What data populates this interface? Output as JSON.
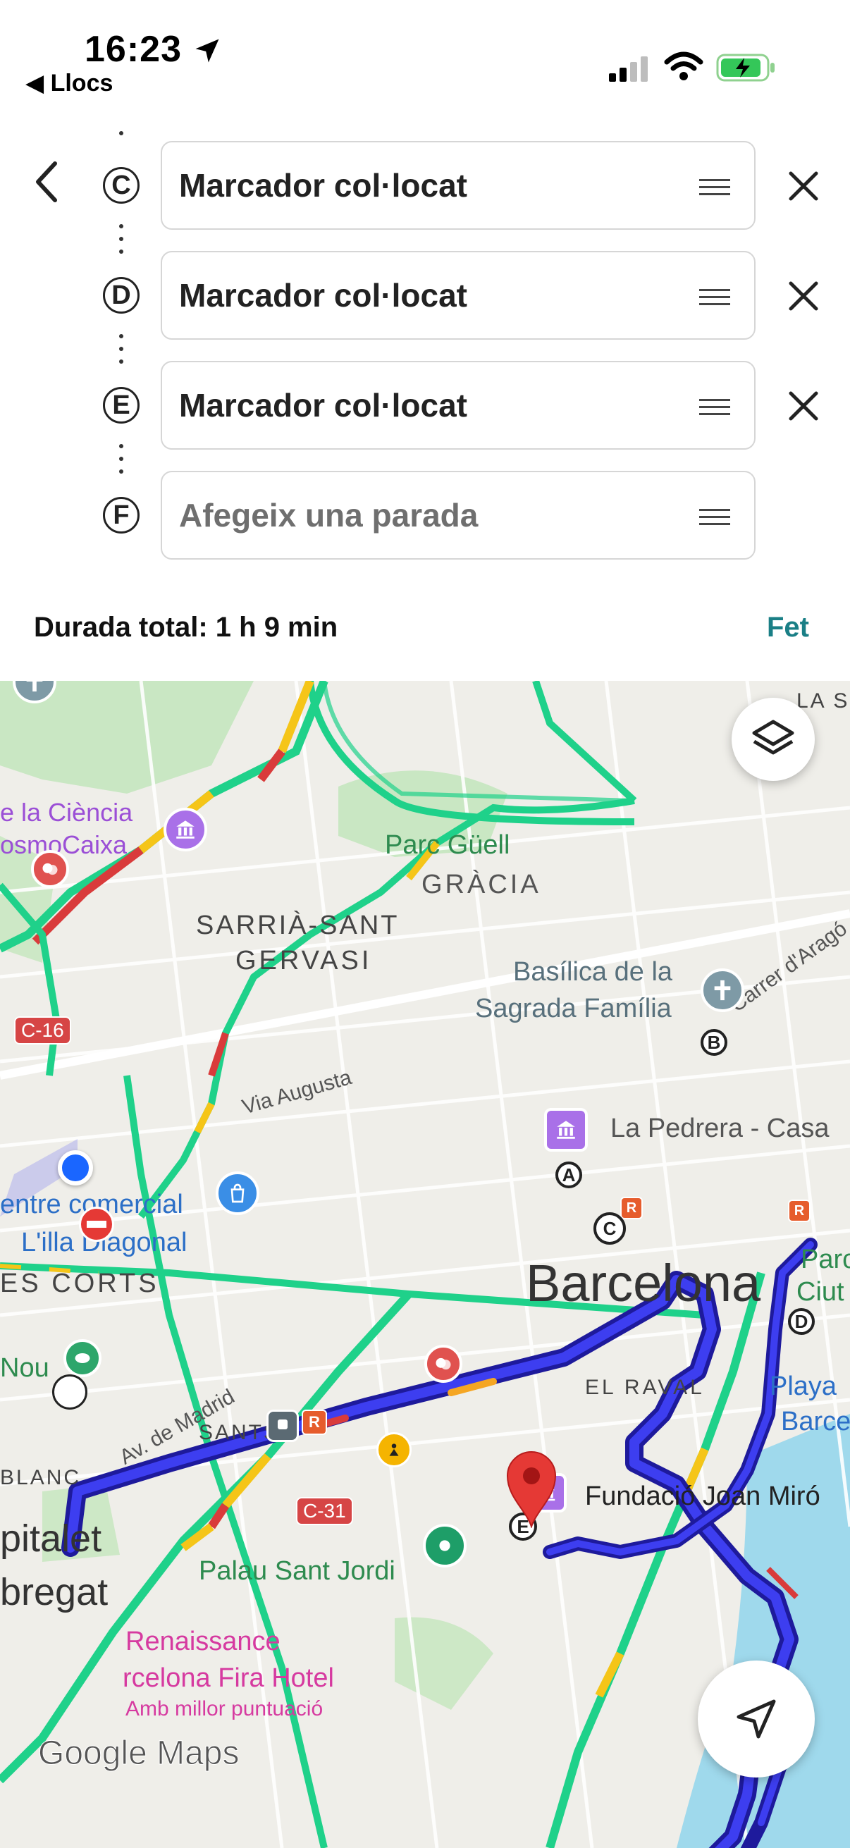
{
  "status_bar": {
    "time": "16:23",
    "back_app": "◀ Llocs"
  },
  "stops": [
    {
      "letter": "C",
      "value": "Marcador col·locat",
      "placeholder": ""
    },
    {
      "letter": "D",
      "value": "Marcador col·locat",
      "placeholder": ""
    },
    {
      "letter": "E",
      "value": "Marcador col·locat",
      "placeholder": ""
    },
    {
      "letter": "F",
      "value": "",
      "placeholder": "Afegeix una parada"
    }
  ],
  "summary": {
    "total_duration": "Durada total: 1 h 9 min",
    "done_label": "Fet"
  },
  "map": {
    "labels": {
      "la_s": "LA S",
      "ciencia": "e la Ciència",
      "cosmocaixa": "osmoCaixa",
      "parc_guell": "Parc Güell",
      "gracia": "GRÀCIA",
      "sarria": "SARRIÀ-SANT",
      "gervasi": "GERVASI",
      "basilica1": "Basílica de la",
      "basilica2": "Sagrada Família",
      "carrer_arago": "Carrer d'Aragó",
      "c16": "C-16",
      "via_augusta": "Via Augusta",
      "pedrera": "La Pedrera - Casa",
      "centre_comercial": "entre comercial",
      "illa": "L'illa Diagonal",
      "les_corts": "ES CORTS",
      "barcelona": "Barcelona",
      "parc": "Parc",
      "ciut": "Ciut",
      "nou": "Nou",
      "av_madrid": "Av. de Madrid",
      "el_raval": "EL RAVAL",
      "playa": "Playa",
      "barcelo": "Barcelo",
      "sants": "SANTS",
      "blanc": "BLANC",
      "c31": "C-31",
      "fundacio": "Fundació Joan Miró",
      "pitalet": "pitalet",
      "bregat": "bregat",
      "palau": "Palau Sant Jordi",
      "renaissance": "Renaissance",
      "fira_hotel": "rcelona Fira Hotel",
      "millor": "Amb millor puntuació",
      "logo": "Google Maps"
    },
    "markers": [
      "A",
      "B",
      "C",
      "D",
      "E"
    ],
    "colors": {
      "route": "#3d3ef0",
      "route_outline": "#1e1a9c",
      "traffic_green": "#1fd18a",
      "traffic_yellow": "#f5c518",
      "traffic_red": "#d93b3b",
      "pin": "#e53935",
      "accent": "#1a7f86"
    }
  }
}
